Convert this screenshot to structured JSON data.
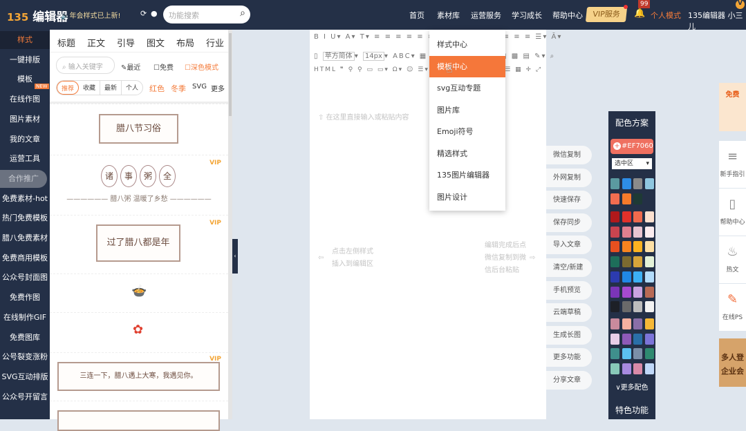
{
  "header": {
    "logo_mark": "135",
    "logo_text": "编辑器",
    "announcement": "🔈年会样式已上新!",
    "search_placeholder": "功能搜索",
    "nav": [
      "首页",
      "素材库",
      "运营服务",
      "学习成长",
      "帮助中心"
    ],
    "vip": "VIP服务",
    "badge": "99",
    "mode": "个人模式",
    "user": "135编辑器 小三儿"
  },
  "sidebar": [
    "样式",
    "一键排版",
    "模板",
    "在线作图",
    "图片素材",
    "我的文章",
    "运营工具",
    "合作推广",
    "免费素材-hot",
    "热门免费模板",
    "腊八免费素材",
    "免费商用模板",
    "公众号封面图",
    "免费作图",
    "在线制作GIF",
    "免费图库",
    "公号裂变涨粉",
    "SVG互动排版",
    "公众号开留言"
  ],
  "new_badge": "NEW",
  "style_panel": {
    "tabs": [
      "标题",
      "正文",
      "引导",
      "图文",
      "布局",
      "行业"
    ],
    "search_placeholder": "输入关键字",
    "recent": "最近",
    "free": "免费",
    "dark": "深色模式",
    "segments": [
      "推荐",
      "收藏",
      "最新",
      "个人"
    ],
    "tags": [
      "红色",
      "冬季",
      "SVG",
      "更多"
    ],
    "vip": "VIP",
    "templates": {
      "t1": "腊八节习俗",
      "t2": [
        "诸",
        "事",
        "粥",
        "全"
      ],
      "t2sub": "腊八粥 温暖了乡愁",
      "t3": "过了腊八都是年",
      "t6": "三连一下，腊八遇上大寒，我遇见你。"
    }
  },
  "editor": {
    "font": "苹方简体",
    "size": "14px",
    "ph_top": "在这里直接输入或粘贴内容",
    "ph_left": [
      "点击左侧样式",
      "插入到编辑区"
    ],
    "ph_right": [
      "编辑完成后点",
      "微信复制到微",
      "信后台粘贴"
    ]
  },
  "menu": {
    "items": [
      "样式中心",
      "模板中心",
      "svg互动专题",
      "图片库",
      "Emoji符号",
      "精选样式",
      "135图片编辑器",
      "图片设计"
    ],
    "active": 1
  },
  "actions": [
    "微信复制",
    "外网复制",
    "快速保存",
    "保存同步",
    "导入文章",
    "清空/新建",
    "手机预览",
    "云端草稿",
    "生成长图",
    "更多功能",
    "分享文章"
  ],
  "color_panel": {
    "title": "配色方案",
    "current": "#EF7060",
    "scope": "选中区",
    "more": "∨更多配色",
    "feature": "特色功能",
    "recent": [
      "#5b9aa0",
      "#2e8de6",
      "#8a8a8a",
      "#8fc7e0",
      "#f26d50",
      "#f57a2a",
      "#1e3a35"
    ],
    "palette": [
      "#b0191b",
      "#e0312a",
      "#ef6a4d",
      "#fbe0cf",
      "#c9444f",
      "#e07f8f",
      "#e8c4d0",
      "#fbecef",
      "#e8501f",
      "#f6831f",
      "#fbb220",
      "#fde0a5",
      "#1d6e5a",
      "#7c6a30",
      "#d6a43a",
      "#e4f2d8",
      "#2c3bb0",
      "#2088e5",
      "#3cb0f5",
      "#b3dcfb",
      "#7b35b8",
      "#a64ad0",
      "#c9a3e0",
      "#b86a55",
      "#1d2027",
      "#6a6a6a",
      "#bdbdbd",
      "#f2f2f2"
    ],
    "gradients": [
      "#c98a9d",
      "#f4b0a0",
      "#8a6fa8",
      "#f6b836",
      "#e8cde8",
      "#8e5ab8",
      "#2a6fa8",
      "#7c74d8",
      "#3f8f8c",
      "#5cc0f0",
      "#7c8fa8",
      "#2f8a70",
      "#88c8b8",
      "#a78ae0",
      "#d98aa8",
      "#c0d8f8"
    ]
  },
  "right_strip": {
    "promo": "免费",
    "items": [
      "新手指引",
      "帮助中心",
      "热文",
      "在线PS"
    ],
    "banner": [
      "多人登",
      "企业会"
    ]
  }
}
